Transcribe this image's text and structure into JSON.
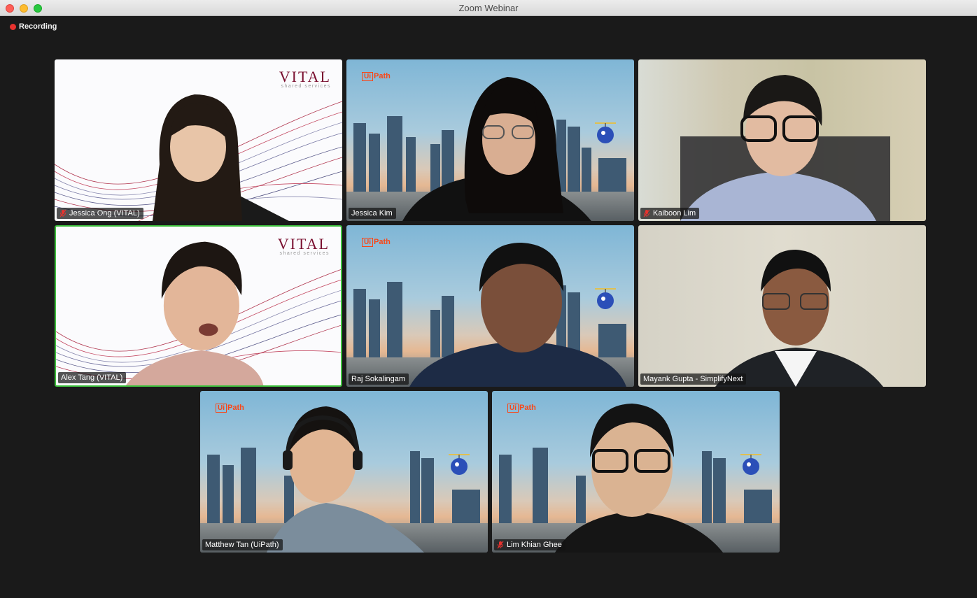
{
  "window": {
    "title": "Zoom Webinar"
  },
  "recording": {
    "label": "Recording",
    "color": "#e8322e"
  },
  "colors": {
    "active_speaker_border": "#3cbf3c",
    "uipath_brand": "#fa4616",
    "vital_brand": "#7a1030",
    "muted_mic": "#e8322e"
  },
  "branding": {
    "vital_logo": "VITAL",
    "vital_sub": "shared services",
    "uipath_logo_box": "Ui",
    "uipath_logo_text": "Path"
  },
  "participants": [
    {
      "name": "Jessica Ong (VITAL)",
      "muted": true,
      "background": "vital",
      "active": false,
      "icon": "mic-muted-icon"
    },
    {
      "name": "Jessica Kim",
      "muted": false,
      "background": "uipath",
      "active": false
    },
    {
      "name": "Kaiboon Lim",
      "muted": true,
      "background": "room",
      "active": false,
      "icon": "mic-muted-icon"
    },
    {
      "name": "Alex Tang (VITAL)",
      "muted": false,
      "background": "vital",
      "active": true
    },
    {
      "name": "Raj Sokalingam",
      "muted": false,
      "background": "uipath",
      "active": false
    },
    {
      "name": "Mayank Gupta - SimplifyNext",
      "muted": false,
      "background": "room",
      "active": false
    },
    {
      "name": "Matthew Tan (UiPath)",
      "muted": false,
      "background": "uipath",
      "active": false
    },
    {
      "name": "Lim Khian Ghee",
      "muted": true,
      "background": "uipath",
      "active": false,
      "icon": "mic-muted-icon"
    }
  ]
}
